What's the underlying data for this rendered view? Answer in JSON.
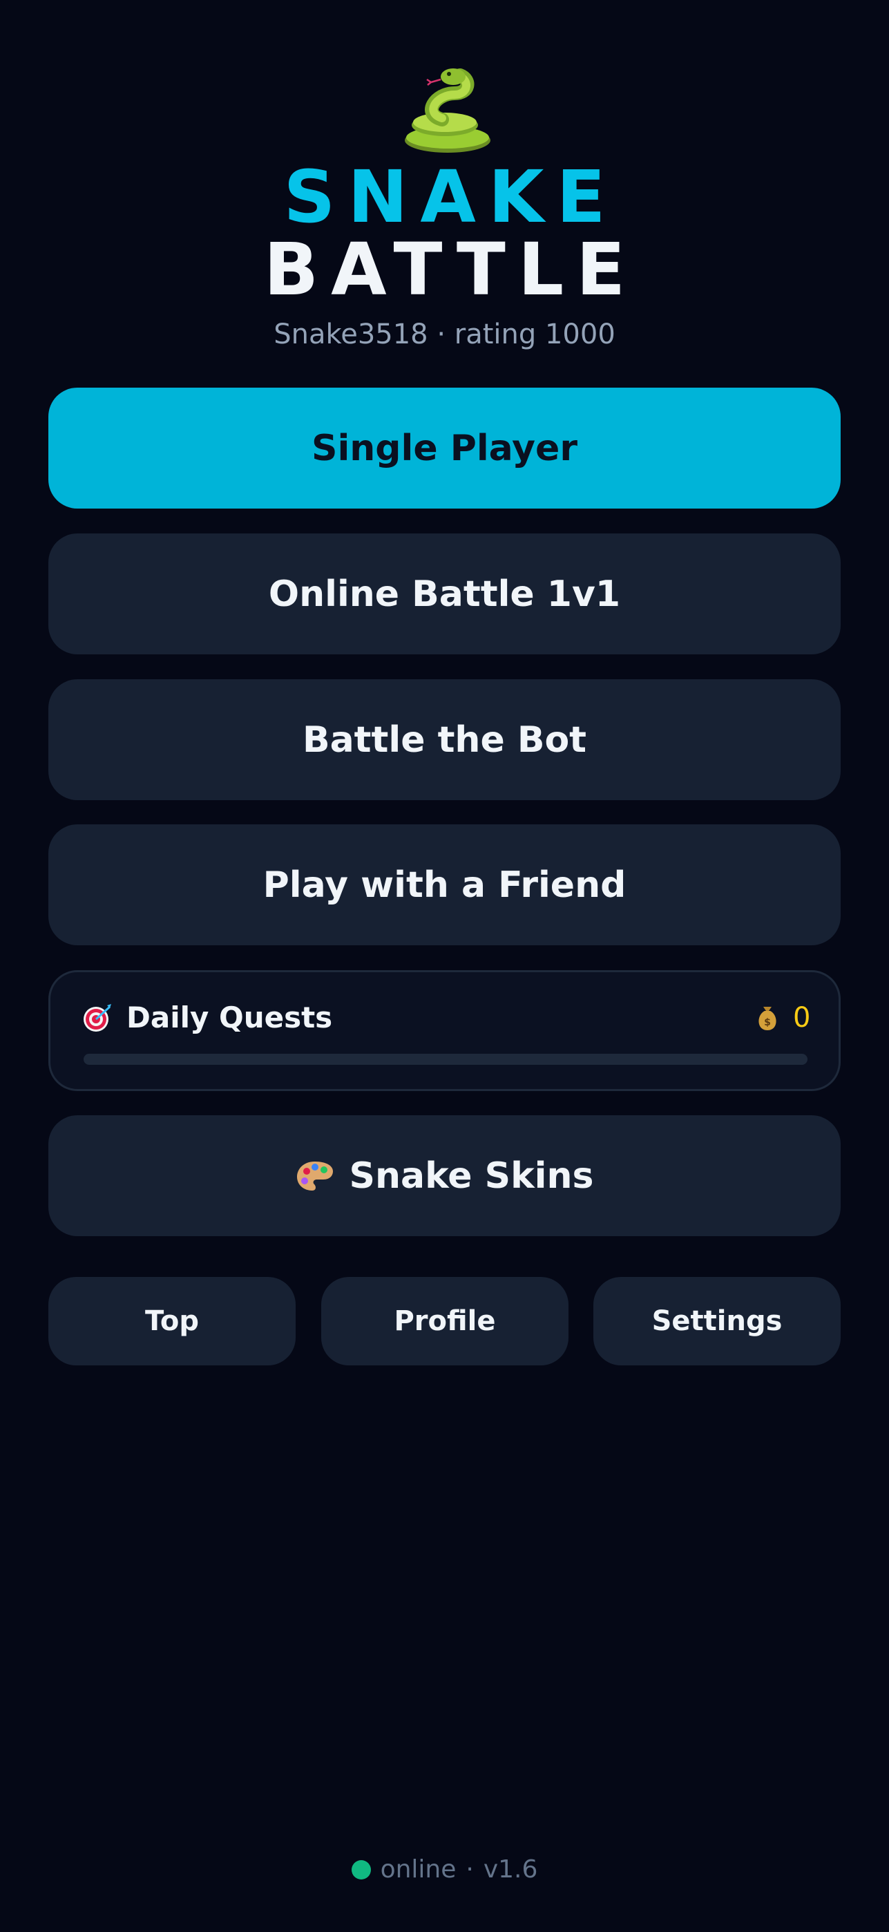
{
  "header": {
    "logo_icon": "snake-emoji",
    "title_line1": "SNAKE",
    "title_line2": "BATTLE",
    "player_info": "Snake3518 · rating 1000",
    "accent_color": "#06c3e9"
  },
  "menu": {
    "single_player": "Single Player",
    "online_battle": "Online Battle 1v1",
    "battle_bot": "Battle the Bot",
    "play_friend": "Play with a Friend"
  },
  "quests": {
    "icon": "target-icon",
    "label": "Daily Quests",
    "coin_icon": "money-bag-icon",
    "coins": "0",
    "progress": 0
  },
  "skins": {
    "icon": "palette-icon",
    "label": "Snake Skins"
  },
  "bottom_nav": {
    "top": "Top",
    "profile": "Profile",
    "settings": "Settings"
  },
  "footer": {
    "status": "online",
    "status_color": "#10b981",
    "separator": "·",
    "version": "v1.6"
  }
}
